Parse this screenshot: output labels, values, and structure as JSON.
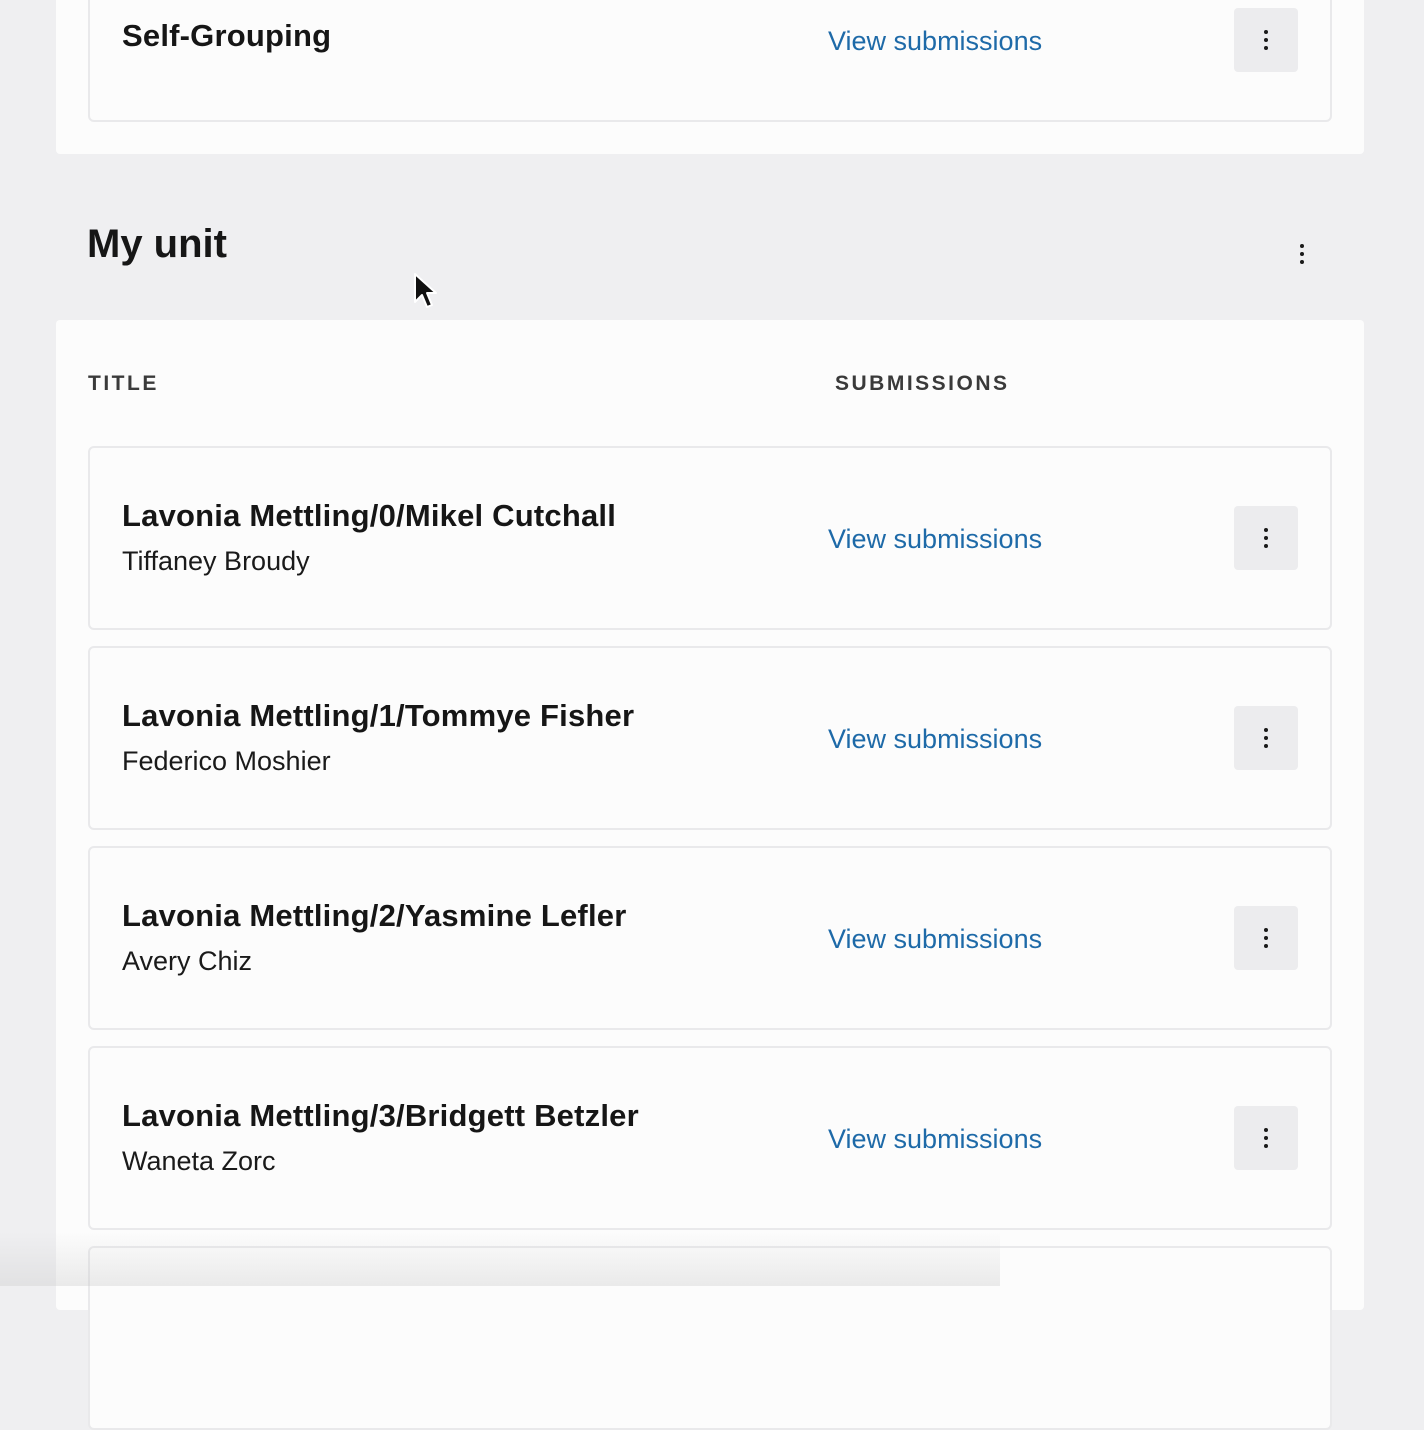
{
  "top_section": {
    "card": {
      "title": "Self-Grouping",
      "link": "View submissions",
      "menu_icon": "more-vertical-icon"
    }
  },
  "unit_section": {
    "heading": "My unit",
    "menu_icon": "more-vertical-icon",
    "columns": {
      "title": "TITLE",
      "submissions": "SUBMISSIONS"
    },
    "items": [
      {
        "title": "Lavonia Mettling/0/Mikel Cutchall",
        "subtitle": "Tiffaney Broudy",
        "link": "View submissions"
      },
      {
        "title": "Lavonia Mettling/1/Tommye Fisher",
        "subtitle": "Federico Moshier",
        "link": "View submissions"
      },
      {
        "title": "Lavonia Mettling/2/Yasmine Lefler",
        "subtitle": "Avery Chiz",
        "link": "View submissions"
      },
      {
        "title": "Lavonia Mettling/3/Bridgett Betzler",
        "subtitle": "Waneta Zorc",
        "link": "View submissions"
      }
    ]
  },
  "colors": {
    "page_bg": "#efeff1",
    "panel_bg": "#fcfcfc",
    "link": "#1e6aa8",
    "button_bg": "#ececee"
  }
}
